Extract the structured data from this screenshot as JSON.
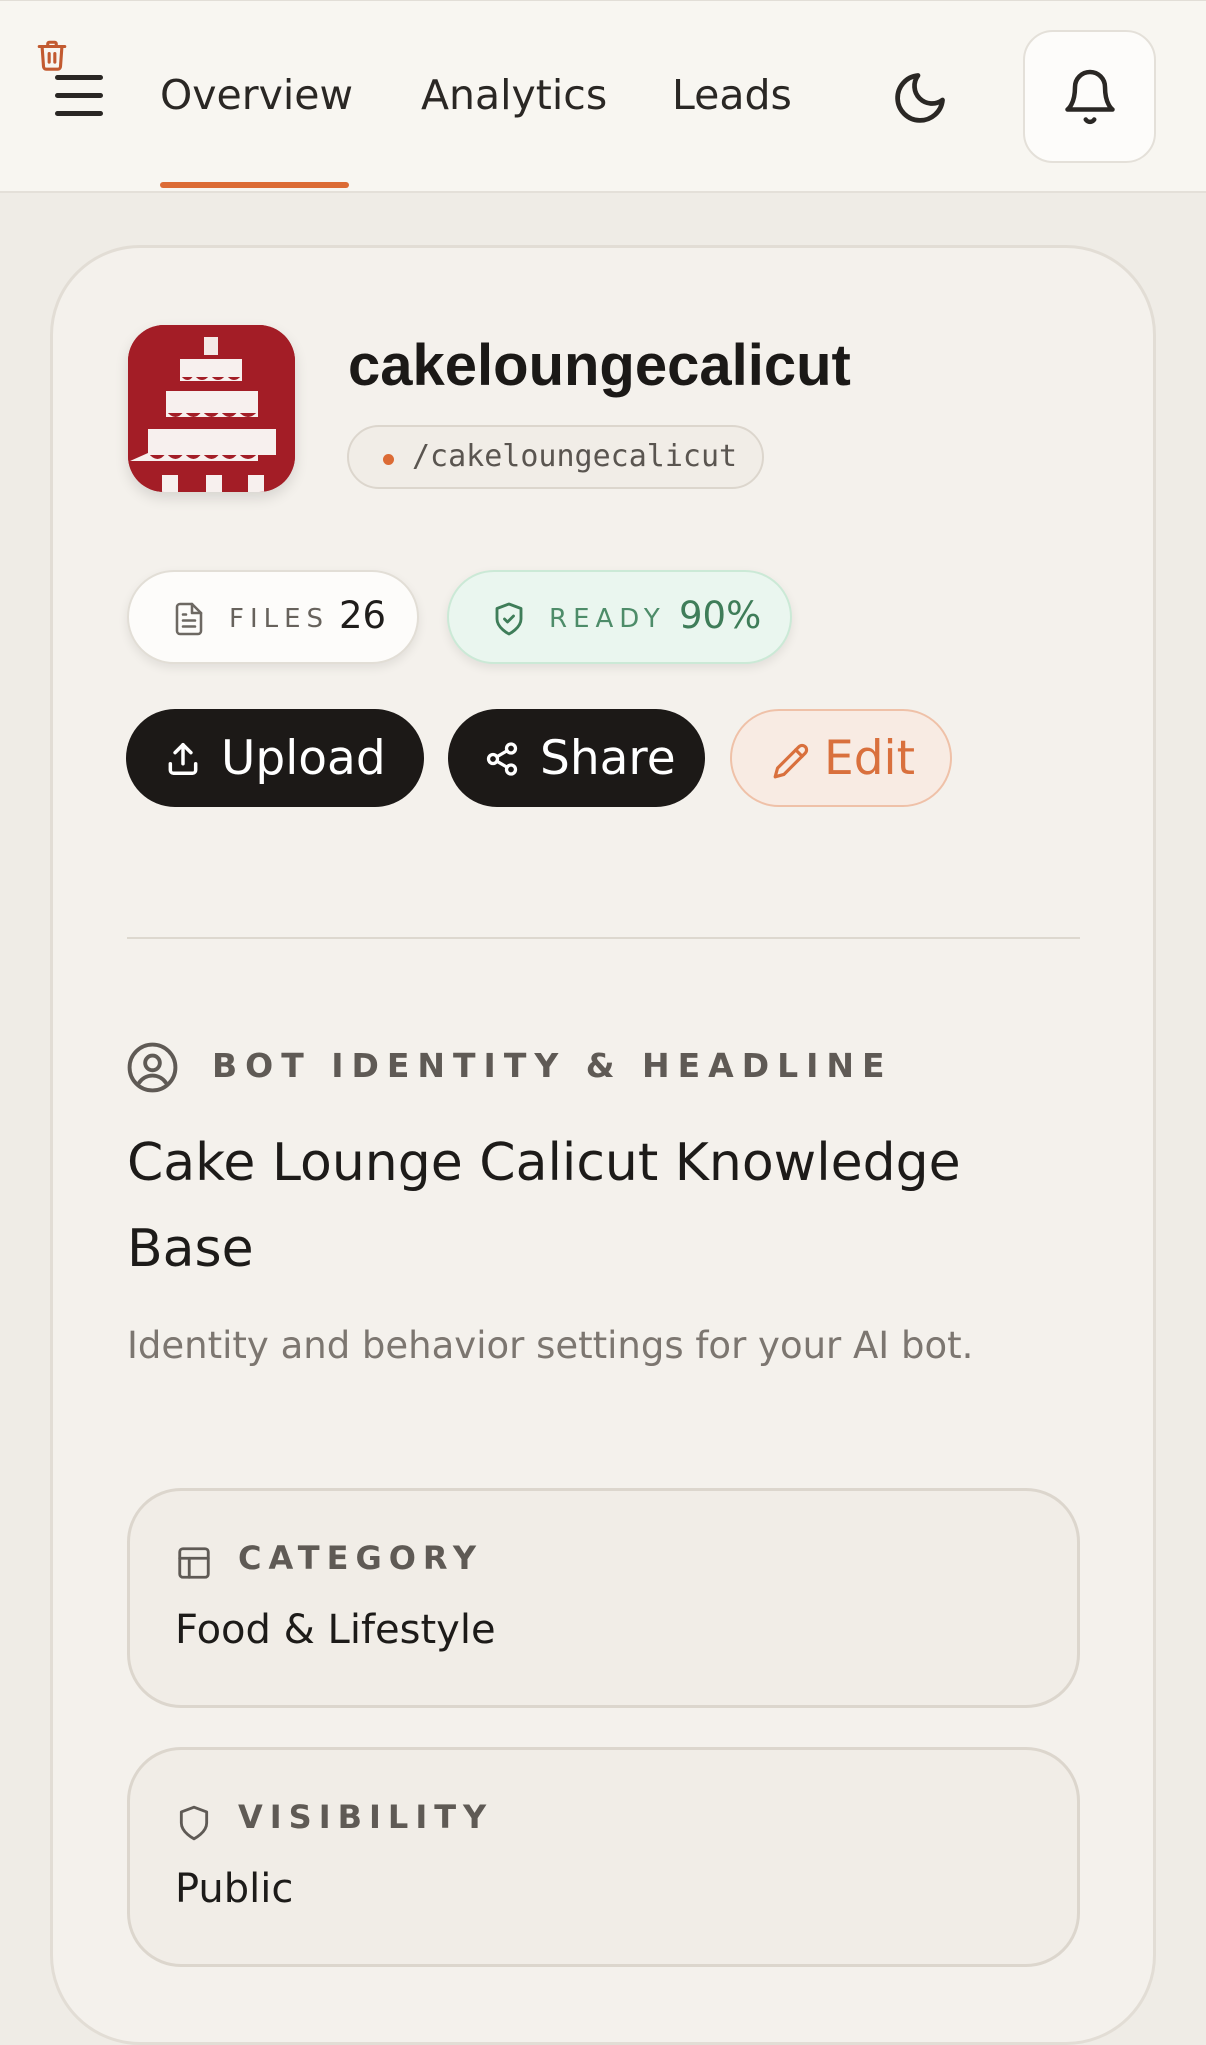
{
  "nav": {
    "tabs": [
      {
        "label": "Overview",
        "active": true
      },
      {
        "label": "Analytics",
        "active": false
      },
      {
        "label": "Leads",
        "active": false
      }
    ],
    "menu_icon": "hamburger-menu-icon",
    "theme_icon": "moon-icon",
    "notifications_icon": "bell-icon",
    "accent_color": "#dc6b35"
  },
  "profile": {
    "name": "cakeloungecalicut",
    "handle": "/cakeloungecalicut",
    "avatar_icon": "cake-logo",
    "avatar_color": "#a31d26"
  },
  "stats": {
    "files_label": "FILES",
    "files_value": "26",
    "files_icon": "document-icon",
    "ready_label": "READY",
    "ready_value": "90%",
    "ready_fraction": 0.9,
    "ready_icon": "shield-check-icon",
    "ready_color": "#3f7d59"
  },
  "actions": {
    "upload_label": "Upload",
    "share_label": "Share",
    "edit_label": "Edit",
    "delete_icon": "trash-icon"
  },
  "identity": {
    "section_title": "BOT IDENTITY & HEADLINE",
    "section_icon": "user-circle-icon",
    "headline": "Cake Lounge Calicut Knowledge Base",
    "description": "Identity and behavior settings for your AI bot."
  },
  "fields": {
    "category": {
      "label": "CATEGORY",
      "value": "Food & Lifestyle",
      "icon": "layout-icon"
    },
    "visibility": {
      "label": "VISIBILITY",
      "value": "Public",
      "icon": "shield-icon"
    }
  }
}
